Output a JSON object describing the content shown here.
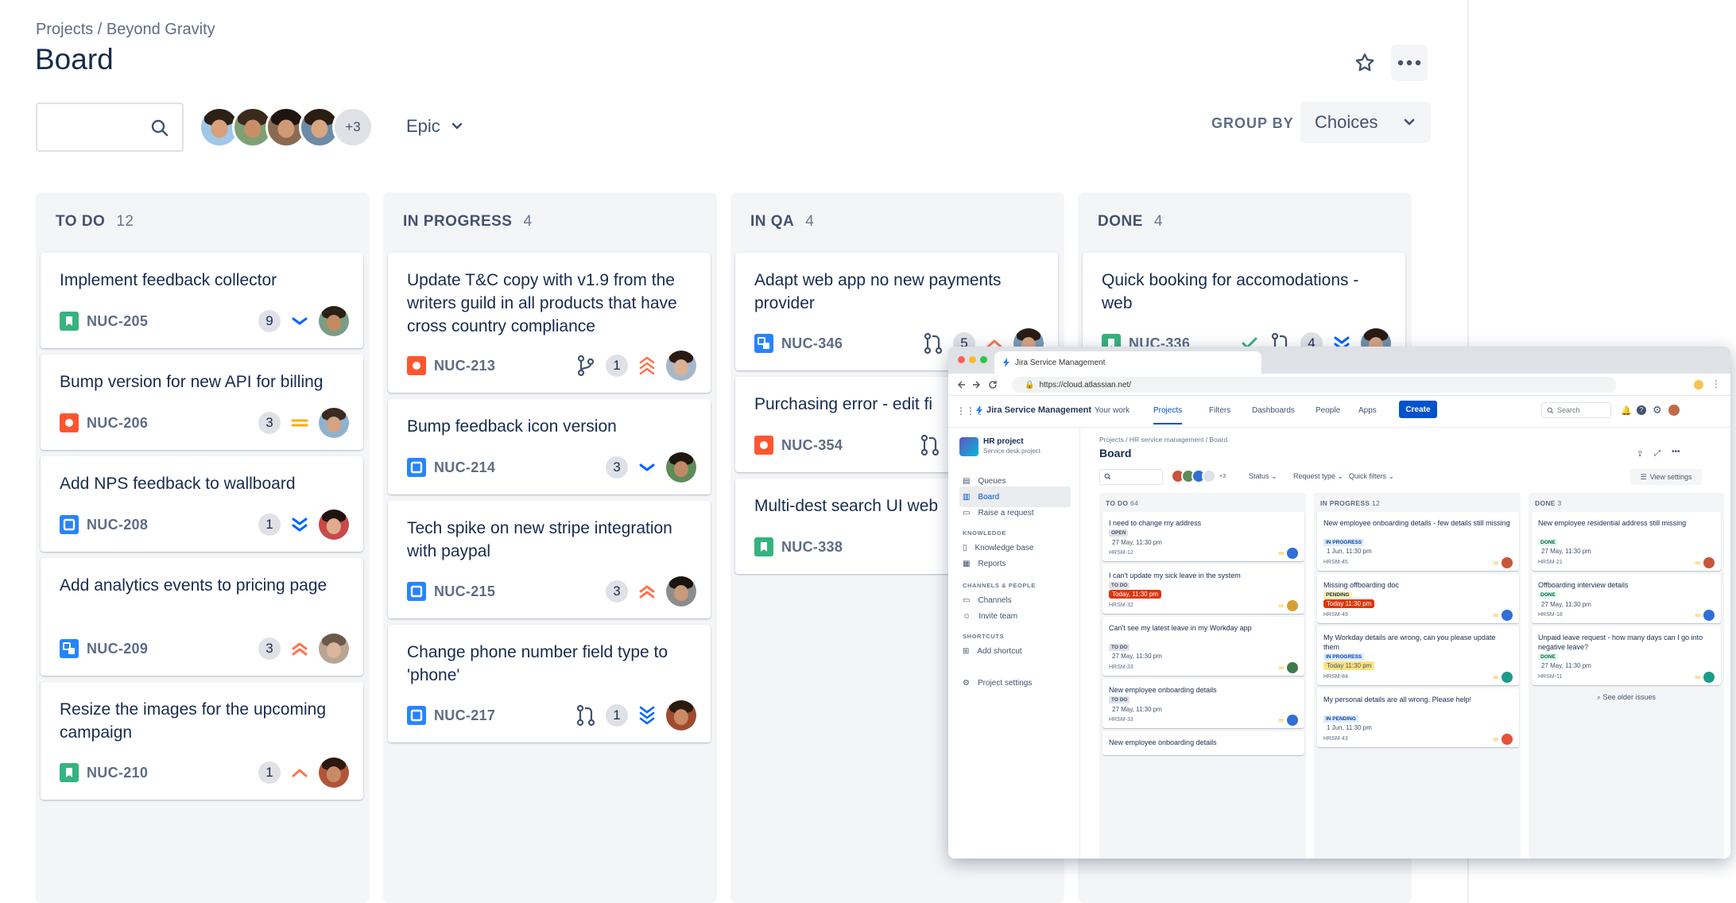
{
  "breadcrumb": "Projects / Beyond Gravity",
  "page_title": "Board",
  "search": {
    "placeholder": ""
  },
  "avatars_more": "+3",
  "epic_filter": "Epic",
  "group_by": {
    "label": "GROUP BY",
    "value": "Choices"
  },
  "columns": [
    {
      "title": "TO DO",
      "count": "12",
      "cards": [
        {
          "title": "Implement feedback collector",
          "key": "NUC-205",
          "type": "story",
          "badge": "9",
          "priority": "low"
        },
        {
          "title": "Bump version for new API for billing",
          "key": "NUC-206",
          "type": "bug",
          "badge": "3",
          "priority": "medium"
        },
        {
          "title": "Add NPS feedback to wallboard",
          "key": "NUC-208",
          "type": "task",
          "badge": "1",
          "priority": "lowest"
        },
        {
          "title": "Add analytics events to pricing page",
          "key": "NUC-209",
          "type": "subtask",
          "badge": "3",
          "priority": "high"
        },
        {
          "title": "Resize the images for the upcoming campaign",
          "key": "NUC-210",
          "type": "story",
          "badge": "1",
          "priority": "medium-high"
        }
      ]
    },
    {
      "title": "IN PROGRESS",
      "count": "4",
      "cards": [
        {
          "title": "Update T&C copy with v1.9 from the writers guild in all products that have cross country compliance",
          "key": "NUC-213",
          "type": "bug",
          "badge": "1",
          "priority": "highest"
        },
        {
          "title": "Bump feedback icon version",
          "key": "NUC-214",
          "type": "task",
          "badge": "3",
          "priority": "low"
        },
        {
          "title": "Tech spike on new stripe integration with paypal",
          "key": "NUC-215",
          "type": "task",
          "badge": "3",
          "priority": "high"
        },
        {
          "title": "Change phone number field type to 'phone'",
          "key": "NUC-217",
          "type": "task",
          "badge": "1",
          "priority": "lowest"
        }
      ]
    },
    {
      "title": "IN QA",
      "count": "4",
      "cards": [
        {
          "title": "Adapt web app no new payments provider",
          "key": "NUC-346",
          "type": "subtask",
          "badge": "5",
          "priority": "medium-high"
        },
        {
          "title": "Purchasing error - edit fi",
          "key": "NUC-354",
          "type": "bug",
          "badge": "",
          "priority": ""
        },
        {
          "title": "Multi-dest search UI web",
          "key": "NUC-338",
          "type": "story",
          "badge": "",
          "priority": ""
        }
      ]
    },
    {
      "title": "DONE",
      "count": "4",
      "cards": [
        {
          "title": "Quick booking for accomodations - web",
          "key": "NUC-336",
          "type": "story",
          "badge": "4",
          "priority": "lowest"
        }
      ]
    }
  ],
  "inset": {
    "tab_title": "Jira Service Management",
    "url": "https://cloud.atlassian.net/",
    "product": "Jira Service Management",
    "nav": [
      "Your work",
      "Projects",
      "Filters",
      "Dashboards",
      "People",
      "Apps"
    ],
    "create": "Create",
    "search_placeholder": "Search",
    "project_name": "HR project",
    "project_type": "Service desk project",
    "sidebar": {
      "items": [
        "Queues",
        "Board",
        "Raise a request"
      ],
      "knowledge_label": "KNOWLEDGE",
      "knowledge": [
        "Knowledge base",
        "Reports"
      ],
      "channels_label": "CHANNELS & PEOPLE",
      "channels": [
        "Channels",
        "Invite team"
      ],
      "shortcuts_label": "SHORTCUTS",
      "shortcuts": [
        "Add shortcut"
      ],
      "settings": "Project settings"
    },
    "breadcrumb": "Projects  /  HR service management  /  Board",
    "title": "Board",
    "filters": {
      "more": "+3",
      "status": "Status",
      "request_type": "Request type",
      "quick_filters": "Quick filters",
      "view_settings": "View settings"
    },
    "columns": [
      {
        "title": "TO DO",
        "count": "64",
        "cards": [
          {
            "title": "I need to change my address",
            "status": "OPEN",
            "date": "27 May, 11:30 pm",
            "key": "HRSM-12"
          },
          {
            "title": "I can't update my sick leave in the system",
            "status": "TO DO",
            "date": "Today, 11:30 pm",
            "key": "HRSM-32"
          },
          {
            "title": "Can't see my latest leave in my Workday app",
            "status": "TO DO",
            "date": "27 May, 11:30 pm",
            "key": "HRSM-33"
          },
          {
            "title": "New employee onboarding details",
            "status": "TO DO",
            "date": "27 May, 11:30 pm",
            "key": "HRSM-33"
          },
          {
            "title": "New employee onboarding details",
            "status": "",
            "date": "",
            "key": ""
          }
        ]
      },
      {
        "title": "IN PROGRESS",
        "count": "12",
        "cards": [
          {
            "title": "New employee onboarding details - few details still missing",
            "status": "IN PROGRESS",
            "date": "1 Jun, 11:30 pm",
            "key": "HRSM-45"
          },
          {
            "title": "Missing offboarding doc",
            "status": "PENDING",
            "date": "Today 11:30 pm",
            "key": "HRSM-49"
          },
          {
            "title": "My Workday details are wrong, can you please update them",
            "status": "IN PROGRESS",
            "date": "Today 11:30 pm",
            "key": "HRSM-84"
          },
          {
            "title": "My personal details are all wrong. Please help!",
            "status": "IN PENDING",
            "date": "1 Jun, 11:30 pm",
            "key": "HRSM-43"
          }
        ]
      },
      {
        "title": "DONE",
        "count": "3",
        "cards": [
          {
            "title": "New employee residential address still missing",
            "status": "DONE",
            "date": "27 May, 11:30 pm",
            "key": "HRSM-21"
          },
          {
            "title": "Offboarding interview details",
            "status": "DONE",
            "date": "27 May, 11:30 pm",
            "key": "HRSM-18"
          },
          {
            "title": "Unpaid leave request - how many days can I go into negative leave?",
            "status": "DONE",
            "date": "27 May, 11:30 pm",
            "key": "HRSM-11"
          }
        ]
      }
    ],
    "older": "See older issues"
  },
  "colors": {
    "story": "#36b37e",
    "bug": "#ff5630",
    "task": "#2684ff",
    "subtask": "#2684ff",
    "accent": "#0052cc"
  }
}
